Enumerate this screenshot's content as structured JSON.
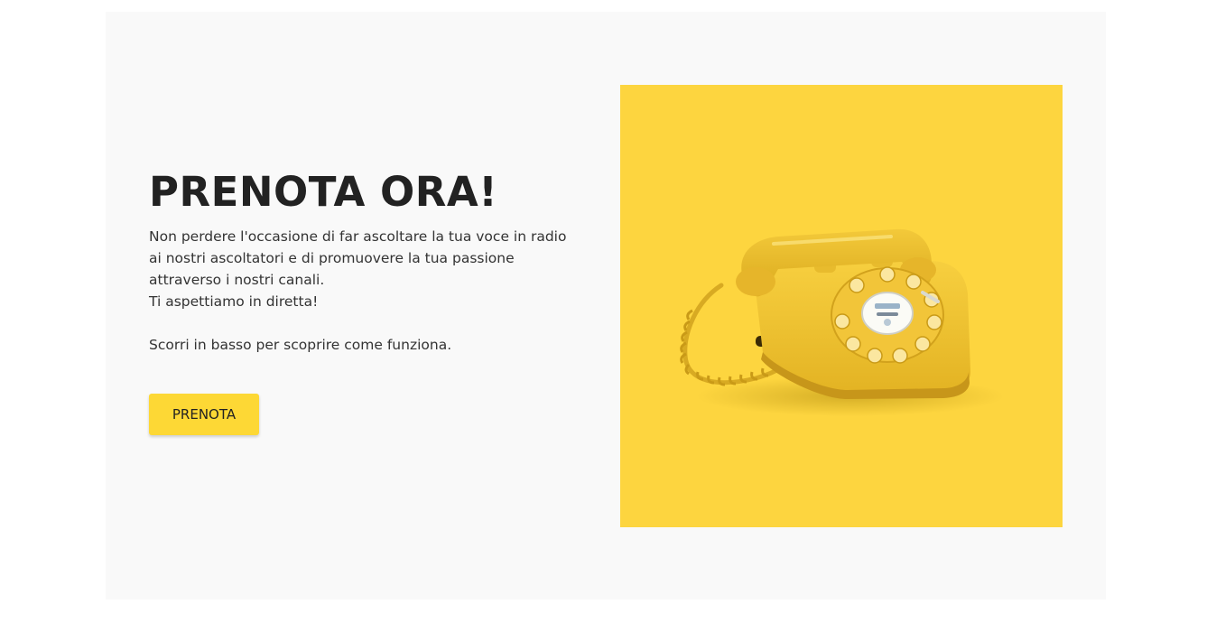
{
  "hero": {
    "title": "PRENOTA ORA!",
    "paragraph_1": "Non perdere l'occasione di far ascoltare la tua voce in radio ai nostri ascoltatori e di promuovere la tua passione attraverso i nostri canali.",
    "paragraph_2": "Ti aspettiamo in diretta!",
    "paragraph_3": "Scorri in basso per scoprire come funziona.",
    "button_label": "PRENOTA"
  },
  "image": {
    "subject": "yellow-rotary-telephone",
    "background_color": "#fdd53f"
  },
  "colors": {
    "card_background": "#f9f9f9",
    "accent": "#fdd835",
    "heading": "#222222",
    "text": "#333333"
  }
}
